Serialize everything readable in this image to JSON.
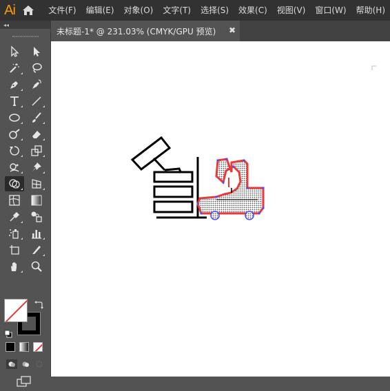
{
  "app": {
    "logo": "Ai"
  },
  "menu": {
    "items": [
      "文件(F)",
      "编辑(E)",
      "对象(O)",
      "文字(T)",
      "选择(S)",
      "效果(C)",
      "视图(V)",
      "窗口(W)",
      "帮助(H)"
    ]
  },
  "toolbar": {
    "collapse_label": "◂◂",
    "tools": [
      [
        "selection-tool",
        "direct-selection-tool"
      ],
      [
        "magic-wand-tool",
        "lasso-tool"
      ],
      [
        "pen-tool",
        "curvature-tool"
      ],
      [
        "type-tool",
        "line-segment-tool"
      ],
      [
        "ellipse-tool",
        "paintbrush-tool"
      ],
      [
        "blob-brush-tool",
        "eraser-tool"
      ],
      [
        "rotate-tool",
        "scale-tool"
      ],
      [
        "puppet-warp-tool",
        "pin-tool"
      ],
      [
        "shape-builder-tool",
        "perspective-grid-tool"
      ],
      [
        "mesh-tool",
        "gradient-tool"
      ],
      [
        "eyedropper-tool",
        "blend-tool"
      ],
      [
        "symbol-sprayer-tool",
        "column-graph-tool"
      ],
      [
        "artboard-tool",
        "slice-tool"
      ],
      [
        "hand-tool",
        "zoom-tool"
      ]
    ],
    "active_tool": "shape-builder-tool"
  },
  "document": {
    "tab_title": "未标题-1* @ 231.03% (CMYK/GPU 预览)",
    "close_glyph": "✖"
  },
  "colors": {
    "menubar": "#323232",
    "toolbar": "#535353",
    "canvas": "#ffffff",
    "logo": "#ff9a00",
    "selection": "#4a4aff",
    "highlight": "#e83a3a"
  }
}
